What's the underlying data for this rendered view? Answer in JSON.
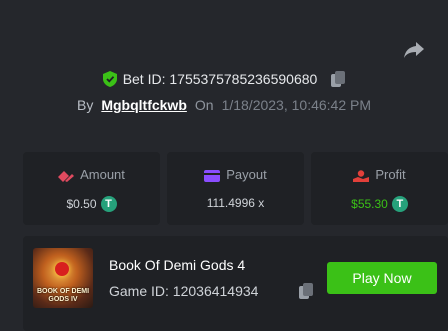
{
  "header": {
    "bet_id_label": "Bet ID: 1755375785236590680",
    "by_label": "By",
    "username": "Mgbqltfckwb",
    "on_label": "On",
    "timestamp": "1/18/2023, 10:46:42 PM"
  },
  "stats": {
    "amount": {
      "label": "Amount",
      "value": "$0.50",
      "icon": "bet-amount-icon",
      "color": "#e04a5f"
    },
    "payout": {
      "label": "Payout",
      "value": "111.4996 x",
      "icon": "payout-card-icon",
      "color": "#8a4dff"
    },
    "profit": {
      "label": "Profit",
      "value": "$55.30",
      "icon": "profit-icon",
      "color": "#e2403a",
      "value_color": "#3bc117"
    }
  },
  "currency": {
    "symbol": "T",
    "color": "#26a17b"
  },
  "game": {
    "title": "Book Of Demi Gods 4",
    "game_id_label": "Game ID: 12036414934",
    "thumbnail_caption": "BOOK OF DEMI GODS IV",
    "play_label": "Play Now",
    "play_color": "#3bc117"
  }
}
